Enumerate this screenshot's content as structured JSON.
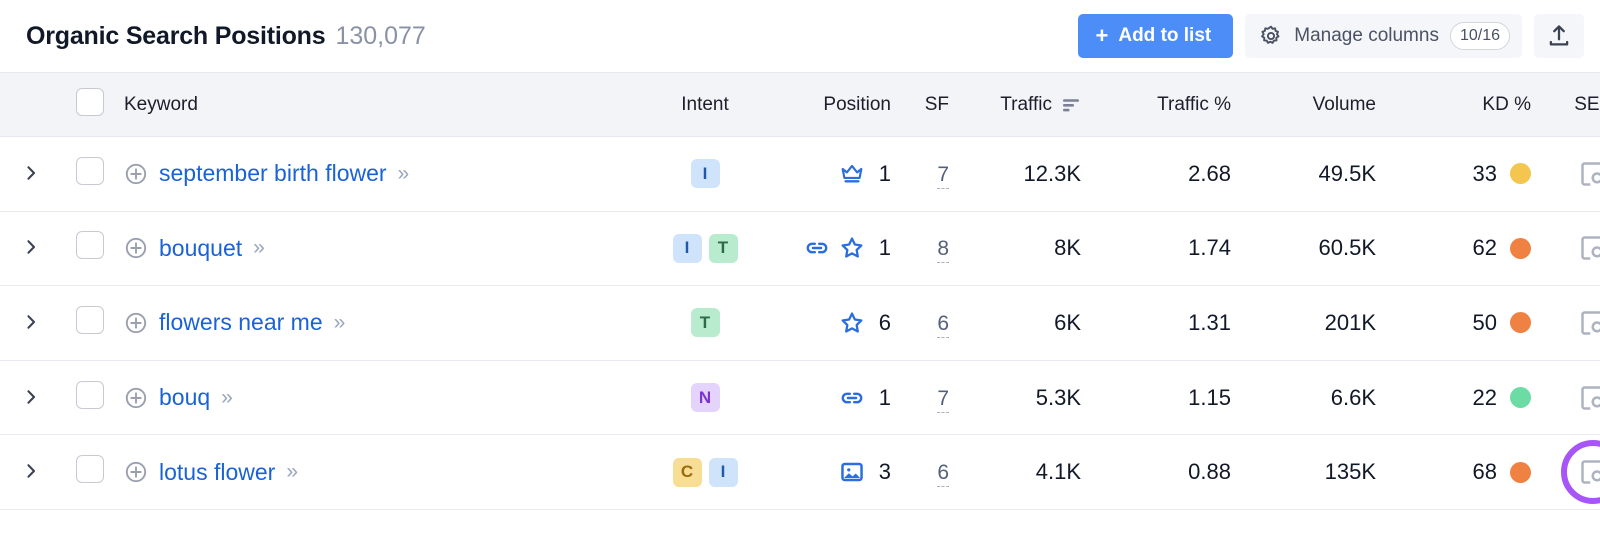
{
  "header": {
    "title": "Organic Search Positions",
    "count": "130,077",
    "add_to_list_label": "Add to list",
    "add_to_list_plus": "+",
    "manage_columns_label": "Manage columns",
    "manage_columns_badge": "10/16",
    "export_icon": "export-upload-icon",
    "gear_icon": "gear-icon"
  },
  "colors": {
    "accent_blue": "#4d8df7",
    "link_blue": "#1a62d6",
    "header_bg": "#f3f4f8",
    "sorted_header_bg": "#dddee7",
    "highlight_ring": "#a855f7",
    "kd_yellow": "#f5c council",
    "kd_orange": "#ef8143",
    "kd_green": "#6ddba4",
    "kd_yellow_hex": "#f5c council"
  },
  "table": {
    "columns": [
      {
        "key": "expand",
        "label": "",
        "align": "center"
      },
      {
        "key": "select",
        "label": "",
        "align": "center"
      },
      {
        "key": "keyword",
        "label": "Keyword",
        "align": "left"
      },
      {
        "key": "intent",
        "label": "Intent",
        "align": "center"
      },
      {
        "key": "position",
        "label": "Position",
        "align": "right"
      },
      {
        "key": "sf",
        "label": "SF",
        "align": "right"
      },
      {
        "key": "traffic",
        "label": "Traffic",
        "align": "right",
        "sorted": true,
        "sort_icon": "sort-descending-icon"
      },
      {
        "key": "traffic_pct",
        "label": "Traffic %",
        "align": "right"
      },
      {
        "key": "volume",
        "label": "Volume",
        "align": "right"
      },
      {
        "key": "kd",
        "label": "KD %",
        "align": "right"
      },
      {
        "key": "serp",
        "label": "SERP",
        "align": "right"
      }
    ],
    "select_all_checkbox": false,
    "rows": [
      {
        "keyword": "september birth flower",
        "intents": [
          "I"
        ],
        "position_icons": [
          "crown-icon"
        ],
        "position": "1",
        "sf": "7",
        "traffic": "12.3K",
        "traffic_pct": "2.68",
        "volume": "49.5K",
        "kd": "33",
        "kd_color": "#f5c council",
        "serp_icon": "serp-preview-icon",
        "highlighted": false
      },
      {
        "keyword": "bouquet",
        "intents": [
          "I",
          "T"
        ],
        "position_icons": [
          "link-icon",
          "star-icon"
        ],
        "position": "1",
        "sf": "8",
        "traffic": "8K",
        "traffic_pct": "1.74",
        "volume": "60.5K",
        "kd": "62",
        "kd_color": "#ef8143",
        "serp_icon": "serp-preview-icon",
        "highlighted": false
      },
      {
        "keyword": "flowers near me",
        "intents": [
          "T"
        ],
        "position_icons": [
          "star-icon"
        ],
        "position": "6",
        "sf": "6",
        "traffic": "6K",
        "traffic_pct": "1.31",
        "volume": "201K",
        "kd": "50",
        "kd_color": "#ef8143",
        "serp_icon": "serp-preview-icon",
        "highlighted": false
      },
      {
        "keyword": "bouq",
        "intents": [
          "N"
        ],
        "position_icons": [
          "link-icon"
        ],
        "position": "1",
        "sf": "7",
        "traffic": "5.3K",
        "traffic_pct": "1.15",
        "volume": "6.6K",
        "kd": "22",
        "kd_color": "#6ddba4",
        "serp_icon": "serp-preview-icon",
        "highlighted": false
      },
      {
        "keyword": "lotus flower",
        "intents": [
          "C",
          "I"
        ],
        "position_icons": [
          "image-icon"
        ],
        "position": "3",
        "sf": "6",
        "traffic": "4.1K",
        "traffic_pct": "0.88",
        "volume": "135K",
        "kd": "68",
        "kd_color": "#ef8143",
        "serp_icon": "serp-preview-icon",
        "highlighted": true
      }
    ]
  }
}
